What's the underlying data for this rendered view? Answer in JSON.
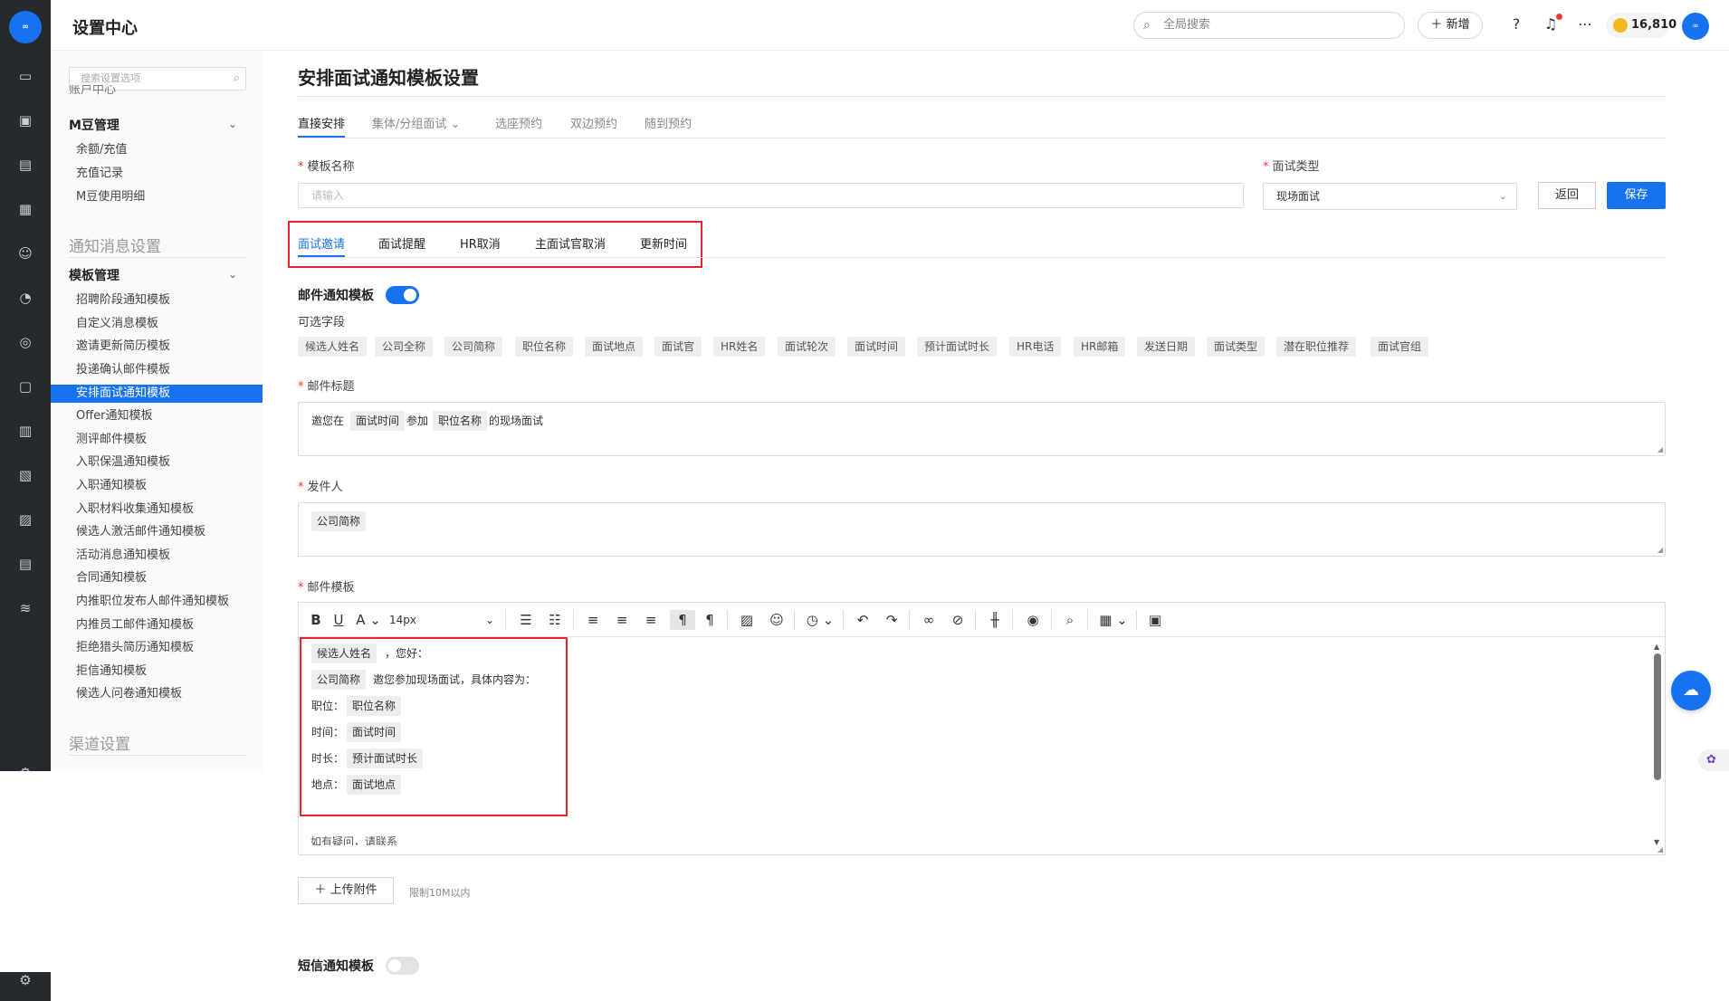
{
  "app": {
    "title": "设置中心"
  },
  "header": {
    "search_placeholder": "全局搜索",
    "new_label": "新增",
    "coins": "16,810"
  },
  "sidebar": {
    "search_placeholder": "搜索设置选项",
    "clipped_item": "账户中心",
    "group_mbean": "M豆管理",
    "mbean_items": [
      "余额/充值",
      "充值记录",
      "M豆使用明细"
    ],
    "section_notify": "通知消息设置",
    "group_template": "模板管理",
    "template_items": [
      "招聘阶段通知模板",
      "自定义消息模板",
      "邀请更新简历模板",
      "投递确认邮件模板",
      "安排面试通知模板",
      "Offer通知模板",
      "测评邮件模板",
      "入职保温通知模板",
      "入职通知模板",
      "入职材料收集通知模板",
      "候选人激活邮件通知模板",
      "活动消息通知模板",
      "合同通知模板",
      "内推职位发布人邮件通知模板",
      "内推员工邮件通知模板",
      "拒绝猎头简历通知模板",
      "拒信通知模板",
      "候选人问卷通知模板"
    ],
    "active_index": 4,
    "section_channel": "渠道设置"
  },
  "main": {
    "page_title": "安排面试通知模板设置",
    "tabs": [
      "直接安排",
      "集体/分组面试",
      "选座预约",
      "双边预约",
      "随到预约"
    ],
    "active_tab": 0,
    "template_name_label": "模板名称",
    "template_name_placeholder": "请输入",
    "interview_type_label": "面试类型",
    "interview_type_value": "现场面试",
    "back_label": "返回",
    "save_label": "保存",
    "subtabs": [
      "面试邀请",
      "面试提醒",
      "HR取消",
      "主面试官取消",
      "更新时间"
    ],
    "active_subtab": 0,
    "email_toggle_label": "邮件通知模板",
    "email_enabled": true,
    "fields_label": "可选字段",
    "fields": [
      "候选人姓名",
      "公司全称",
      "公司简称",
      "职位名称",
      "面试地点",
      "面试官",
      "HR姓名",
      "面试轮次",
      "面试时间",
      "预计面试时长",
      "HR电话",
      "HR邮箱",
      "发送日期",
      "面试类型",
      "潜在职位推荐",
      "面试官组"
    ],
    "subject_label": "邮件标题",
    "subject": {
      "t1": "邀您在",
      "tag1": "面试时间",
      "t2": "参加",
      "tag2": "职位名称",
      "t3": "的现场面试"
    },
    "sender_label": "发件人",
    "sender_tag": "公司简称",
    "body_label": "邮件模板",
    "font_size": "14px",
    "body": {
      "tag_name": "候选人姓名",
      "greet": "，您好：",
      "tag_company": "公司简称",
      "intro": "邀您参加现场面试，具体内容为：",
      "k_pos": "职位：",
      "v_pos": "职位名称",
      "k_time": "时间：",
      "v_time": "面试时间",
      "k_dur": "时长：",
      "v_dur": "预计面试时长",
      "k_loc": "地点：",
      "v_loc": "面试地点",
      "tail": "如有疑问，请联系"
    },
    "upload_label": "上传附件",
    "upload_note": "限制10M以内",
    "sms_toggle_label": "短信通知模板",
    "sms_enabled": false
  },
  "colors": {
    "accent": "#1672ee",
    "highlight_border": "#e8232a",
    "rail": "#26292e"
  }
}
